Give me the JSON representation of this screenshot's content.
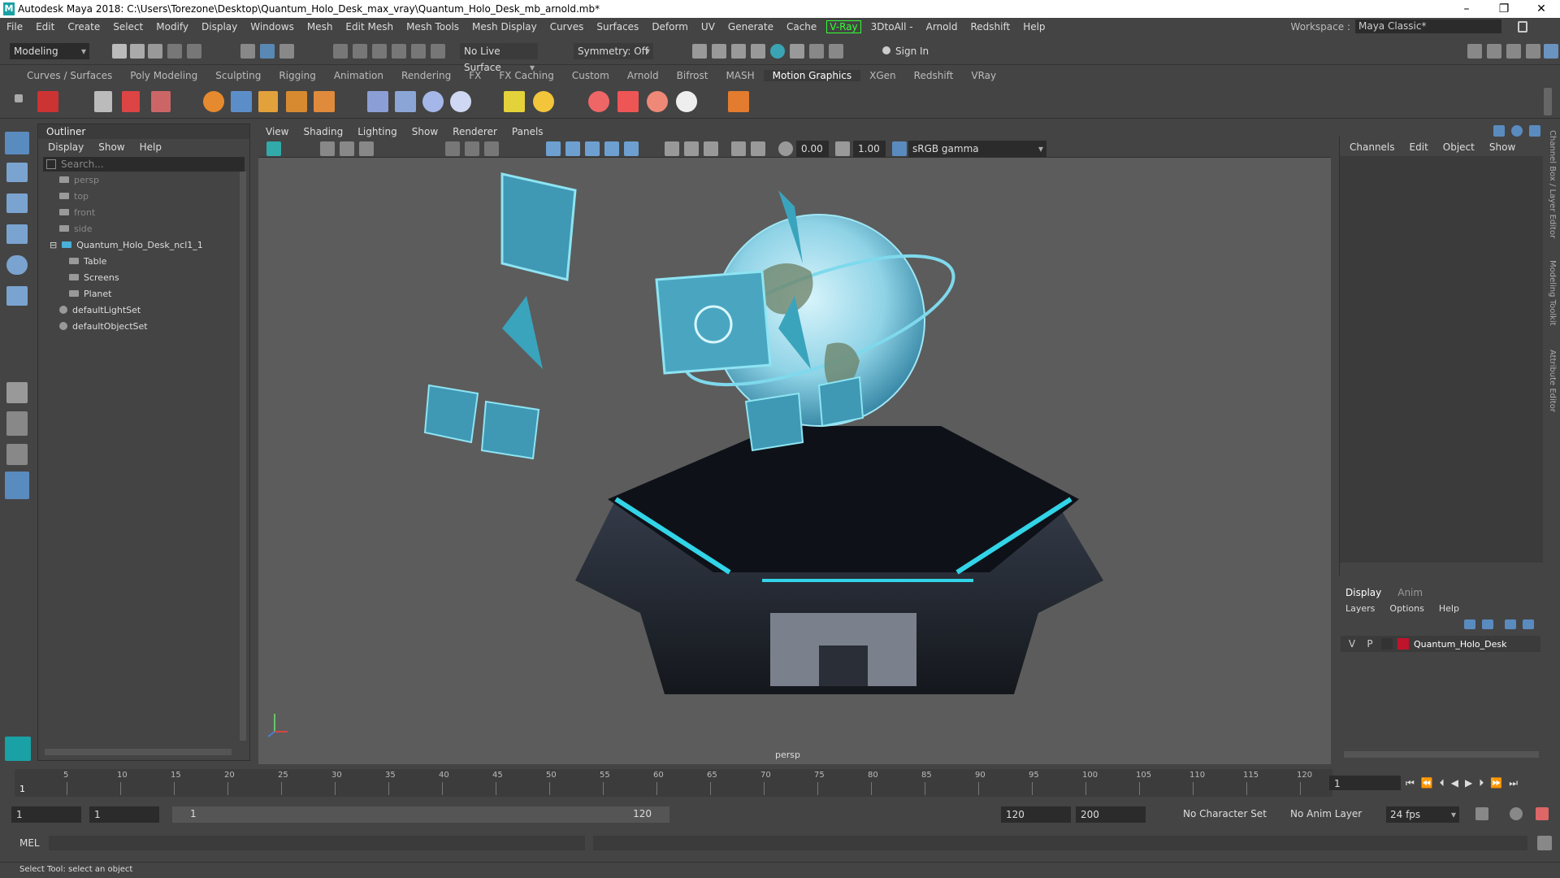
{
  "window": {
    "title": "Autodesk Maya 2018: C:\\Users\\Torezone\\Desktop\\Quantum_Holo_Desk_max_vray\\Quantum_Holo_Desk_mb_arnold.mb*"
  },
  "menubar": [
    "File",
    "Edit",
    "Create",
    "Select",
    "Modify",
    "Display",
    "Windows",
    "Mesh",
    "Edit Mesh",
    "Mesh Tools",
    "Mesh Display",
    "Curves",
    "Surfaces",
    "Deform",
    "UV",
    "Generate",
    "Cache",
    "V-Ray",
    "3DtoAll -",
    "Arnold",
    "Redshift",
    "Help"
  ],
  "workspace": {
    "label": "Workspace :",
    "value": "Maya Classic*"
  },
  "toolbar": {
    "mode": "Modeling",
    "live_surface": "No Live Surface",
    "symmetry": "Symmetry: Off",
    "sign_in": "Sign In"
  },
  "shelf_tabs": [
    "Curves / Surfaces",
    "Poly Modeling",
    "Sculpting",
    "Rigging",
    "Animation",
    "Rendering",
    "FX",
    "FX Caching",
    "Custom",
    "Arnold",
    "Bifrost",
    "MASH",
    "Motion Graphics",
    "XGen",
    "Redshift",
    "VRay"
  ],
  "shelf_active": "Motion Graphics",
  "outliner": {
    "title": "Outliner",
    "menu": [
      "Display",
      "Show",
      "Help"
    ],
    "search_placeholder": "Search...",
    "items": [
      {
        "label": "persp",
        "dim": true,
        "indent": 1
      },
      {
        "label": "top",
        "dim": true,
        "indent": 1
      },
      {
        "label": "front",
        "dim": true,
        "indent": 1
      },
      {
        "label": "side",
        "dim": true,
        "indent": 1
      },
      {
        "label": "Quantum_Holo_Desk_ncl1_1",
        "dim": false,
        "indent": 0
      },
      {
        "label": "Table",
        "dim": false,
        "indent": 2
      },
      {
        "label": "Screens",
        "dim": false,
        "indent": 2
      },
      {
        "label": "Planet",
        "dim": false,
        "indent": 2
      },
      {
        "label": "defaultLightSet",
        "dim": false,
        "indent": 1
      },
      {
        "label": "defaultObjectSet",
        "dim": false,
        "indent": 1
      }
    ]
  },
  "viewport": {
    "menu": [
      "View",
      "Shading",
      "Lighting",
      "Show",
      "Renderer",
      "Panels"
    ],
    "exposure": "0.00",
    "gamma": "1.00",
    "colorspace": "sRGB gamma",
    "camera_label": "persp"
  },
  "channelbox": {
    "menu": [
      "Channels",
      "Edit",
      "Object",
      "Show"
    ]
  },
  "layers": {
    "tabs": [
      "Display",
      "Anim"
    ],
    "menu": [
      "Layers",
      "Options",
      "Help"
    ],
    "layer": {
      "v": "V",
      "p": "P",
      "name": "Quantum_Holo_Desk",
      "color": "#c0142c"
    }
  },
  "side_tabs": [
    "Channel Box / Layer Editor",
    "Modeling Toolkit",
    "Attribute Editor"
  ],
  "timeline": {
    "ticks": [
      "5",
      "10",
      "15",
      "20",
      "25",
      "30",
      "35",
      "40",
      "45",
      "50",
      "55",
      "60",
      "65",
      "70",
      "75",
      "80",
      "85",
      "90",
      "95",
      "100",
      "105",
      "110",
      "115",
      "120"
    ],
    "current": "1",
    "current_field": "1"
  },
  "range": {
    "start": "1",
    "anim_start": "1",
    "range_start": "1",
    "range_end": "120",
    "anim_end": "120",
    "end": "200",
    "character_set": "No Character Set",
    "anim_layer": "No Anim Layer",
    "fps": "24 fps"
  },
  "mel": {
    "label": "MEL"
  },
  "status": {
    "text": "Select Tool: select an object"
  }
}
